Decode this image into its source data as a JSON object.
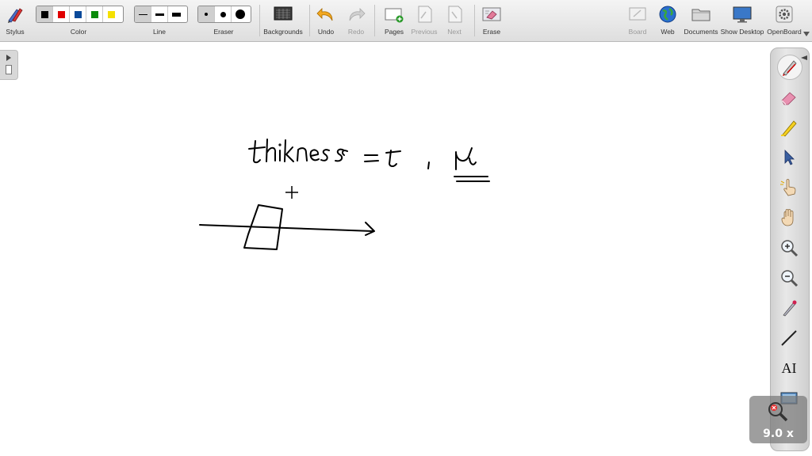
{
  "toolbar": {
    "stylus_label": "Stylus",
    "color_label": "Color",
    "line_label": "Line",
    "eraser_label": "Eraser",
    "backgrounds_label": "Backgrounds",
    "undo_label": "Undo",
    "redo_label": "Redo",
    "pages_label": "Pages",
    "previous_label": "Previous",
    "next_label": "Next",
    "erase_label": "Erase",
    "board_label": "Board",
    "web_label": "Web",
    "documents_label": "Documents",
    "show_desktop_label": "Show Desktop",
    "openboard_label": "OpenBoard"
  },
  "colors": {
    "swatches": [
      "#000000",
      "#e00000",
      "#0a4a9a",
      "#0a8a0a",
      "#f5e000"
    ],
    "selected_index": 0
  },
  "line": {
    "selected_index": 0
  },
  "eraser": {
    "selected_index": 0
  },
  "dock": {
    "tools": [
      "pen-icon",
      "eraser-icon",
      "highlighter-icon",
      "selector-icon",
      "interact-icon",
      "hand-icon",
      "zoom-in-icon",
      "zoom-out-icon",
      "laser-pointer-icon",
      "line-icon",
      "text-icon",
      "capture-icon"
    ],
    "text_tool_glyph": "AI"
  },
  "zoom_indicator": {
    "text": "9.0 x"
  },
  "handwriting": {
    "text": "thikness = t , μ"
  }
}
